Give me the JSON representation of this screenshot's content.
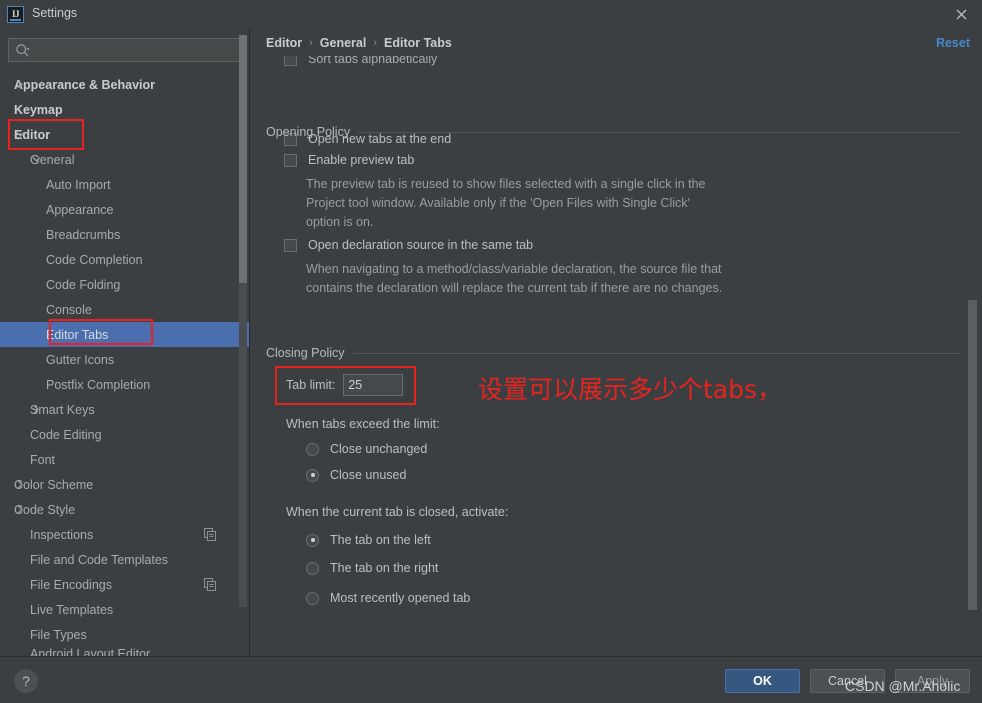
{
  "window": {
    "title": "Settings",
    "logo_text": "IJ",
    "close_icon": "close-icon"
  },
  "reset": {
    "label": "Reset"
  },
  "search": {
    "value": "",
    "placeholder": ""
  },
  "sidebar": {
    "items": [
      {
        "label": "Appearance & Behavior",
        "level": 0,
        "twisty": "chevron-right",
        "bold": true
      },
      {
        "label": "Keymap",
        "level": 0,
        "twisty": "",
        "bold": true
      },
      {
        "label": "Editor",
        "level": 0,
        "twisty": "chevron-down",
        "bold": true
      },
      {
        "label": "General",
        "level": 1,
        "twisty": "chevron-down",
        "bold": false
      },
      {
        "label": "Auto Import",
        "level": 2,
        "twisty": "",
        "bold": false
      },
      {
        "label": "Appearance",
        "level": 2,
        "twisty": "",
        "bold": false
      },
      {
        "label": "Breadcrumbs",
        "level": 2,
        "twisty": "",
        "bold": false
      },
      {
        "label": "Code Completion",
        "level": 2,
        "twisty": "",
        "bold": false
      },
      {
        "label": "Code Folding",
        "level": 2,
        "twisty": "",
        "bold": false
      },
      {
        "label": "Console",
        "level": 2,
        "twisty": "",
        "bold": false
      },
      {
        "label": "Editor Tabs",
        "level": 2,
        "twisty": "",
        "bold": false,
        "selected": true
      },
      {
        "label": "Gutter Icons",
        "level": 2,
        "twisty": "",
        "bold": false
      },
      {
        "label": "Postfix Completion",
        "level": 2,
        "twisty": "",
        "bold": false
      },
      {
        "label": "Smart Keys",
        "level": 1,
        "twisty": "chevron-right",
        "bold": false
      },
      {
        "label": "Code Editing",
        "level": 1,
        "twisty": "",
        "bold": false
      },
      {
        "label": "Font",
        "level": 1,
        "twisty": "",
        "bold": false
      },
      {
        "label": "Color Scheme",
        "level": 0,
        "twisty": "chevron-right",
        "bold": false
      },
      {
        "label": "Code Style",
        "level": 0,
        "twisty": "chevron-right",
        "bold": false
      },
      {
        "label": "Inspections",
        "level": 1,
        "twisty": "",
        "bold": false,
        "badge": "copy-icon"
      },
      {
        "label": "File and Code Templates",
        "level": 1,
        "twisty": "",
        "bold": false
      },
      {
        "label": "File Encodings",
        "level": 1,
        "twisty": "",
        "bold": false,
        "badge": "copy-icon"
      },
      {
        "label": "Live Templates",
        "level": 1,
        "twisty": "",
        "bold": false
      },
      {
        "label": "File Types",
        "level": 1,
        "twisty": "",
        "bold": false
      },
      {
        "label": "Android Layout Editor",
        "level": 1,
        "twisty": "",
        "bold": false,
        "clipped": true
      }
    ]
  },
  "breadcrumb": {
    "items": [
      "Editor",
      "General",
      "Editor Tabs"
    ],
    "separator": "›"
  },
  "main": {
    "clipped_top_checkbox": {
      "label": "Sort tabs alphabetically",
      "checked": false
    },
    "open_new_tabs": {
      "label": "Open new tabs at the end",
      "checked": false
    },
    "opening_policy": {
      "title": "Opening Policy",
      "enable_preview": {
        "label": "Enable preview tab",
        "checked": false,
        "description": "The preview tab is reused to show files selected with a single click in the Project tool window. Available only if the 'Open Files with Single Click' option is on."
      },
      "open_declaration": {
        "label": "Open declaration source in the same tab",
        "checked": false,
        "description": "When navigating to a method/class/variable declaration, the source file that contains the declaration will replace the current tab if there are no changes."
      }
    },
    "closing_policy": {
      "title": "Closing Policy",
      "tab_limit_label": "Tab limit:",
      "tab_limit_value": "25",
      "exceed_label": "When tabs exceed the limit:",
      "exceed_options": [
        {
          "label": "Close unchanged",
          "selected": false
        },
        {
          "label": "Close unused",
          "selected": true
        }
      ],
      "activate_label": "When the current tab is closed, activate:",
      "activate_options": [
        {
          "label": "The tab on the left",
          "selected": true
        },
        {
          "label": "The tab on the right",
          "selected": false
        },
        {
          "label": "Most recently opened tab",
          "selected": false
        }
      ]
    }
  },
  "annotation": {
    "chinese_note": "设置可以展示多少个tabs，",
    "color": "#e8231f"
  },
  "footer": {
    "help_label": "?",
    "ok_label": "OK",
    "cancel_label": "Cancel",
    "apply_label": "Apply"
  },
  "watermark": {
    "text": "CSDN @Mr.Aholic"
  },
  "colors": {
    "background": "#3c3f41",
    "selection": "#4b6eaf",
    "accent_link": "#4a88c7",
    "ok_button": "#365880",
    "annotation_red": "#e8231f"
  }
}
